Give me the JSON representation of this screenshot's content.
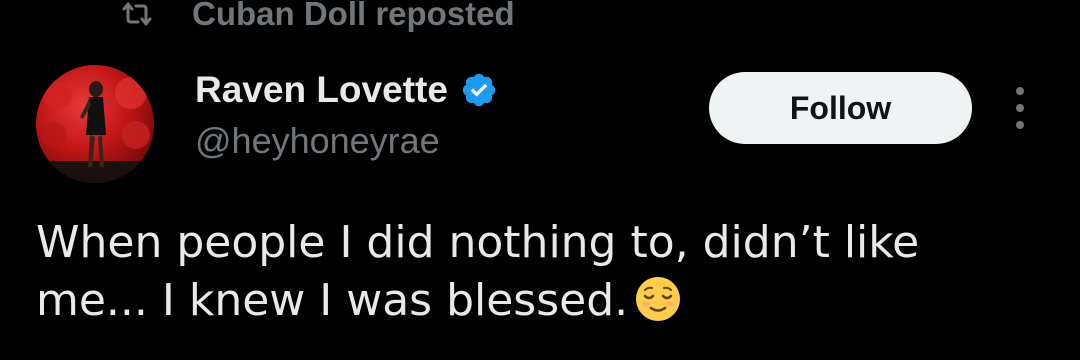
{
  "repost": {
    "icon": "repost-icon",
    "text": "Cuban Doll reposted"
  },
  "author": {
    "display_name": "Raven Lovette",
    "handle": "@heyhoneyrae",
    "verified": true,
    "verified_color": "#1d9bf0",
    "avatar_icon": "avatar"
  },
  "actions": {
    "follow_label": "Follow",
    "more_icon": "more-options-icon"
  },
  "tweet": {
    "line1": "When people I did nothing to, didn’t like",
    "line2": "me... I knew I was blessed.",
    "emoji": "relieved-face-emoji"
  },
  "colors": {
    "background": "#000000",
    "primary_text": "#e7e9ea",
    "secondary_text": "#71767b",
    "button_bg": "#eff3f4",
    "button_text": "#0f1419"
  }
}
